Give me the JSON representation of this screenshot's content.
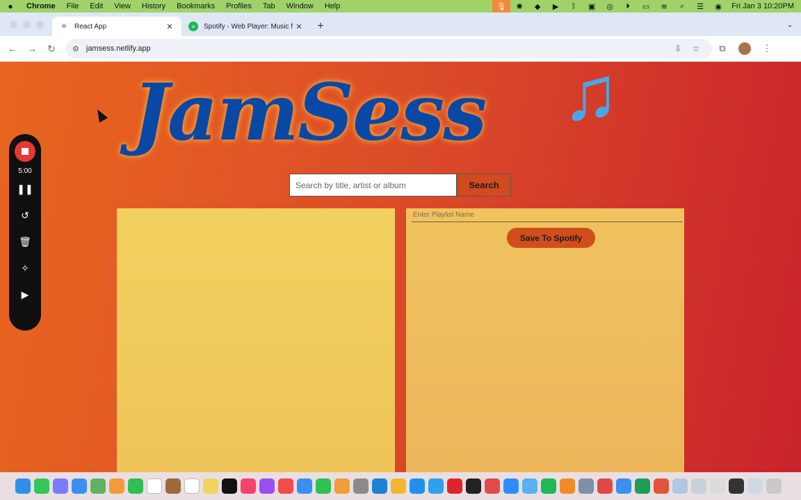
{
  "menubar": {
    "apple": "",
    "app_name": "Chrome",
    "menus": [
      "File",
      "Edit",
      "View",
      "History",
      "Bookmarks",
      "Profiles",
      "Tab",
      "Window",
      "Help"
    ],
    "clock": "Fri Jan 3  10:20PM"
  },
  "browser": {
    "tabs": [
      {
        "title": "React App",
        "favicon": "react-icon"
      },
      {
        "title": "Spotify - Web Player: Music f",
        "favicon": "spotify-icon"
      }
    ],
    "new_tab": "+",
    "url": "jamsess.netlify.app"
  },
  "page": {
    "logo_text": "JamSess",
    "notes": "♫",
    "search": {
      "placeholder": "Search by title, artist or album",
      "button_label": "Search"
    },
    "playlist": {
      "placeholder": "Enter Playlist Name",
      "save_label": "Save To Spotify"
    }
  },
  "recorder": {
    "timer": "5:00"
  },
  "colors": {
    "page_gradient_start": "#e8661f",
    "page_gradient_end": "#c8232b",
    "logo": "#0a48a6",
    "notes": "#4ca6e6",
    "results_panel": "#f2d160",
    "playlist_panel": "#f0c35f",
    "button": "#d14e1c"
  },
  "dock": {
    "icons": [
      {
        "name": "finder-icon",
        "color": "#2f8fe8"
      },
      {
        "name": "messages-icon",
        "color": "#33c759"
      },
      {
        "name": "launchpad-icon",
        "color": "#7a7aff"
      },
      {
        "name": "mail-icon",
        "color": "#3a8ff0"
      },
      {
        "name": "maps-icon",
        "color": "#5fb35f"
      },
      {
        "name": "photos-icon",
        "color": "#f29b38"
      },
      {
        "name": "facetime-icon",
        "color": "#2fbf52"
      },
      {
        "name": "calendar-icon",
        "color": "#ffffff"
      },
      {
        "name": "notes-app-icon",
        "color": "#9c6a3b"
      },
      {
        "name": "reminders-icon",
        "color": "#ffffff"
      },
      {
        "name": "stickies-icon",
        "color": "#f3d35b"
      },
      {
        "name": "tv-icon",
        "color": "#111111"
      },
      {
        "name": "music-icon",
        "color": "#f5436a"
      },
      {
        "name": "podcasts-icon",
        "color": "#9b4ff2"
      },
      {
        "name": "news-icon",
        "color": "#f24b4b"
      },
      {
        "name": "keynote-icon",
        "color": "#3a8ff0"
      },
      {
        "name": "numbers-icon",
        "color": "#2fbf52"
      },
      {
        "name": "pages-icon",
        "color": "#f29b38"
      },
      {
        "name": "system-settings-icon",
        "color": "#8a8a8a"
      },
      {
        "name": "vscode-icon",
        "color": "#1f7fd4"
      },
      {
        "name": "chrome-icon",
        "color": "#f2b632"
      },
      {
        "name": "app-store-icon",
        "color": "#1f8ff0"
      },
      {
        "name": "safari-icon",
        "color": "#2f9ff0"
      },
      {
        "name": "opera-icon",
        "color": "#e0242c"
      },
      {
        "name": "terminal-icon",
        "color": "#222222"
      },
      {
        "name": "voice-memos-icon",
        "color": "#e04a4a"
      },
      {
        "name": "zoom-icon",
        "color": "#2d8cff"
      },
      {
        "name": "preview-icon",
        "color": "#59b1f0"
      },
      {
        "name": "spotify-icon",
        "color": "#1db954"
      },
      {
        "name": "sublime-icon",
        "color": "#f08a25"
      },
      {
        "name": "screenshot-icon",
        "color": "#7f8fa8"
      },
      {
        "name": "folder-icon",
        "color": "#e04848"
      },
      {
        "name": "xcode-icon",
        "color": "#3a8ff0"
      },
      {
        "name": "excel-icon",
        "color": "#1f9d55"
      },
      {
        "name": "powerpoint-icon",
        "color": "#e0563a"
      },
      {
        "name": "finder-window-icon",
        "color": "#b0c8e0"
      },
      {
        "name": "downloads-icon",
        "color": "#c8d0da"
      },
      {
        "name": "documents-icon",
        "color": "#dcdcdc"
      },
      {
        "name": "desktop-icon",
        "color": "#333333"
      },
      {
        "name": "window-icon",
        "color": "#d0d8e4"
      },
      {
        "name": "trash-icon",
        "color": "#c9c9c9"
      }
    ]
  }
}
